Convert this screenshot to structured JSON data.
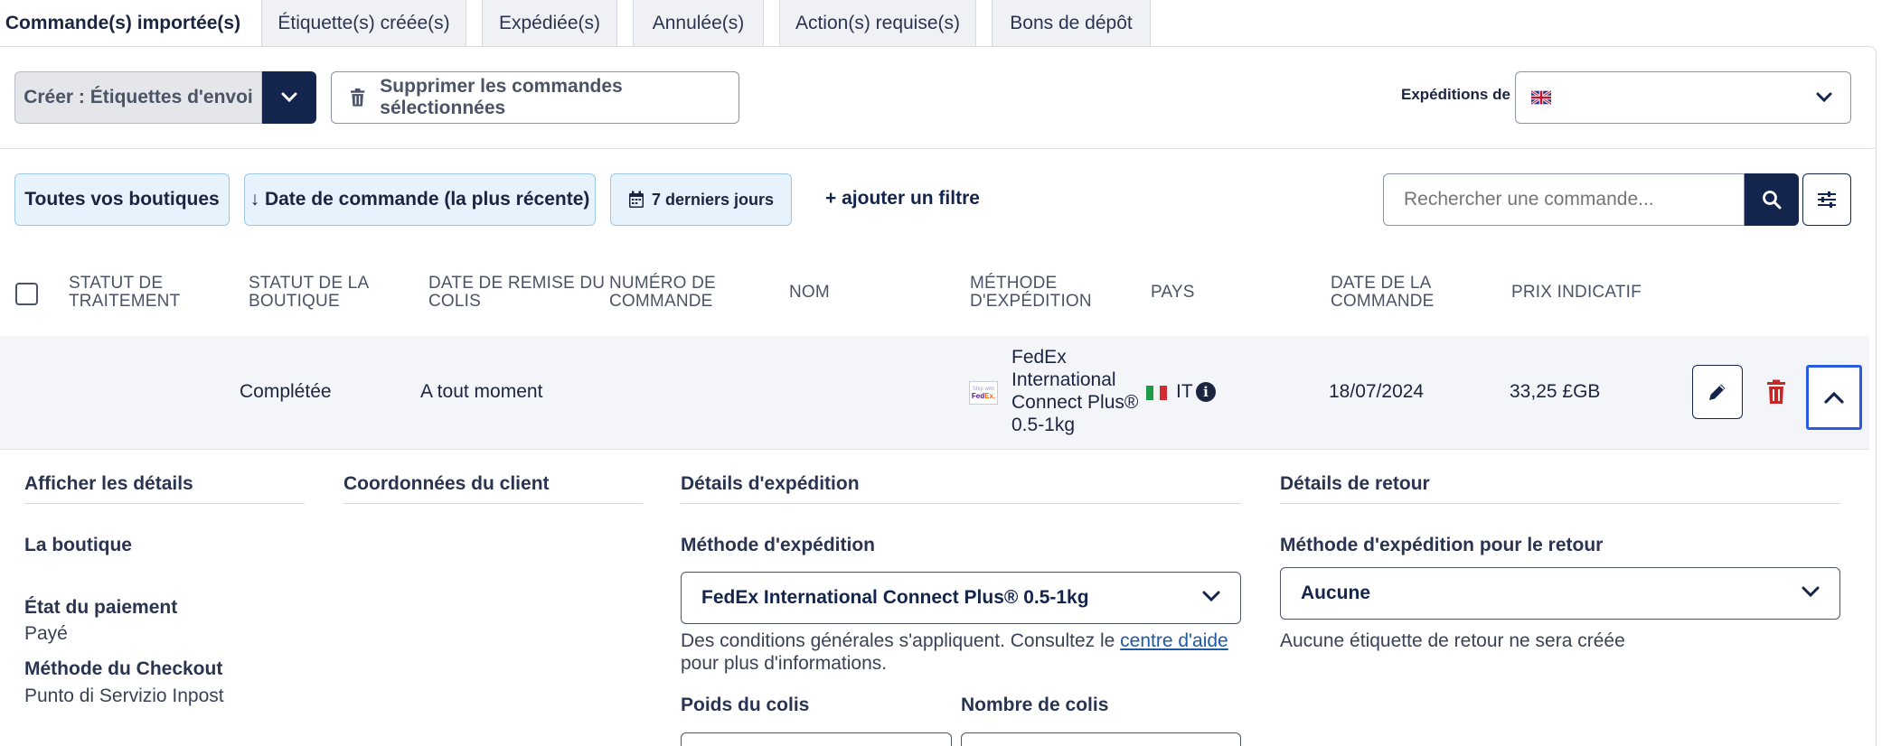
{
  "tabs": [
    {
      "label": "Commande(s) importée(s)"
    },
    {
      "label": "Étiquette(s) créée(s)"
    },
    {
      "label": "Expédiée(s)"
    },
    {
      "label": "Annulée(s)"
    },
    {
      "label": "Action(s) requise(s)"
    },
    {
      "label": "Bons de dépôt"
    }
  ],
  "toolbar": {
    "create_label": "Créer : Étiquettes d'envoi",
    "delete_label": "Supprimer les commandes sélectionnées",
    "shipping_from_label": "Expéditions de",
    "shipping_from_flag": "uk-flag-icon"
  },
  "filters": {
    "shops": "Toutes vos boutiques",
    "sort": "↓ Date de commande (la plus récente)",
    "date_range": "7 derniers jours",
    "add_filter": "+ ajouter un filtre",
    "search_placeholder": "Rechercher une commande..."
  },
  "table": {
    "headers": {
      "processing": [
        "STATUT DE",
        "TRAITEMENT"
      ],
      "shop_status": [
        "STATUT DE LA",
        "BOUTIQUE"
      ],
      "handover": [
        "DATE DE REMISE DU",
        "COLIS"
      ],
      "order_number": [
        "NUMÉRO DE",
        "COMMANDE"
      ],
      "name": "NOM",
      "method": [
        "MÉTHODE",
        "D'EXPÉDITION"
      ],
      "country": "PAYS",
      "order_date": [
        "DATE DE LA",
        "COMMANDE"
      ],
      "price": "PRIX INDICATIF"
    },
    "rows": [
      {
        "shop_status": "Complétée",
        "handover": "A tout moment",
        "method_lines": [
          "FedEx",
          "International",
          "Connect Plus®",
          "0.5-1kg"
        ],
        "method_logo_top": "Ship with",
        "method_logo_fed": "Fed",
        "method_logo_ex": "Ex.",
        "country": "IT",
        "order_date": "18/07/2024",
        "price": "33,25 £GB"
      }
    ]
  },
  "details": {
    "show_details": {
      "title": "Afficher les détails",
      "shop_label": "La boutique",
      "payment_label": "État du paiement",
      "payment_value": "Payé",
      "checkout_label": "Méthode du Checkout",
      "checkout_value": "Punto di Servizio Inpost"
    },
    "customer": {
      "title": "Coordonnées du client"
    },
    "shipping": {
      "title": "Détails d'expédition",
      "method_label": "Méthode d'expédition",
      "method_value": "FedEx International Connect Plus® 0.5-1kg",
      "note_prefix": "Des conditions générales s'appliquent. Consultez le ",
      "note_link": "centre d'aide",
      "note_suffix": "pour plus d'informations.",
      "weight_label": "Poids du colis",
      "parcels_label": "Nombre de colis"
    },
    "return": {
      "title": "Détails de retour",
      "method_label": "Méthode d'expédition pour le retour",
      "method_value": "Aucune",
      "note": "Aucune étiquette de retour ne sera créée"
    }
  },
  "colors": {
    "primary": "#14254d",
    "pill_bg": "#e6f2fc",
    "pill_border": "#9ec6e8",
    "focus": "#2a5ce0",
    "danger": "#c62828",
    "link": "#1d5aa8"
  }
}
